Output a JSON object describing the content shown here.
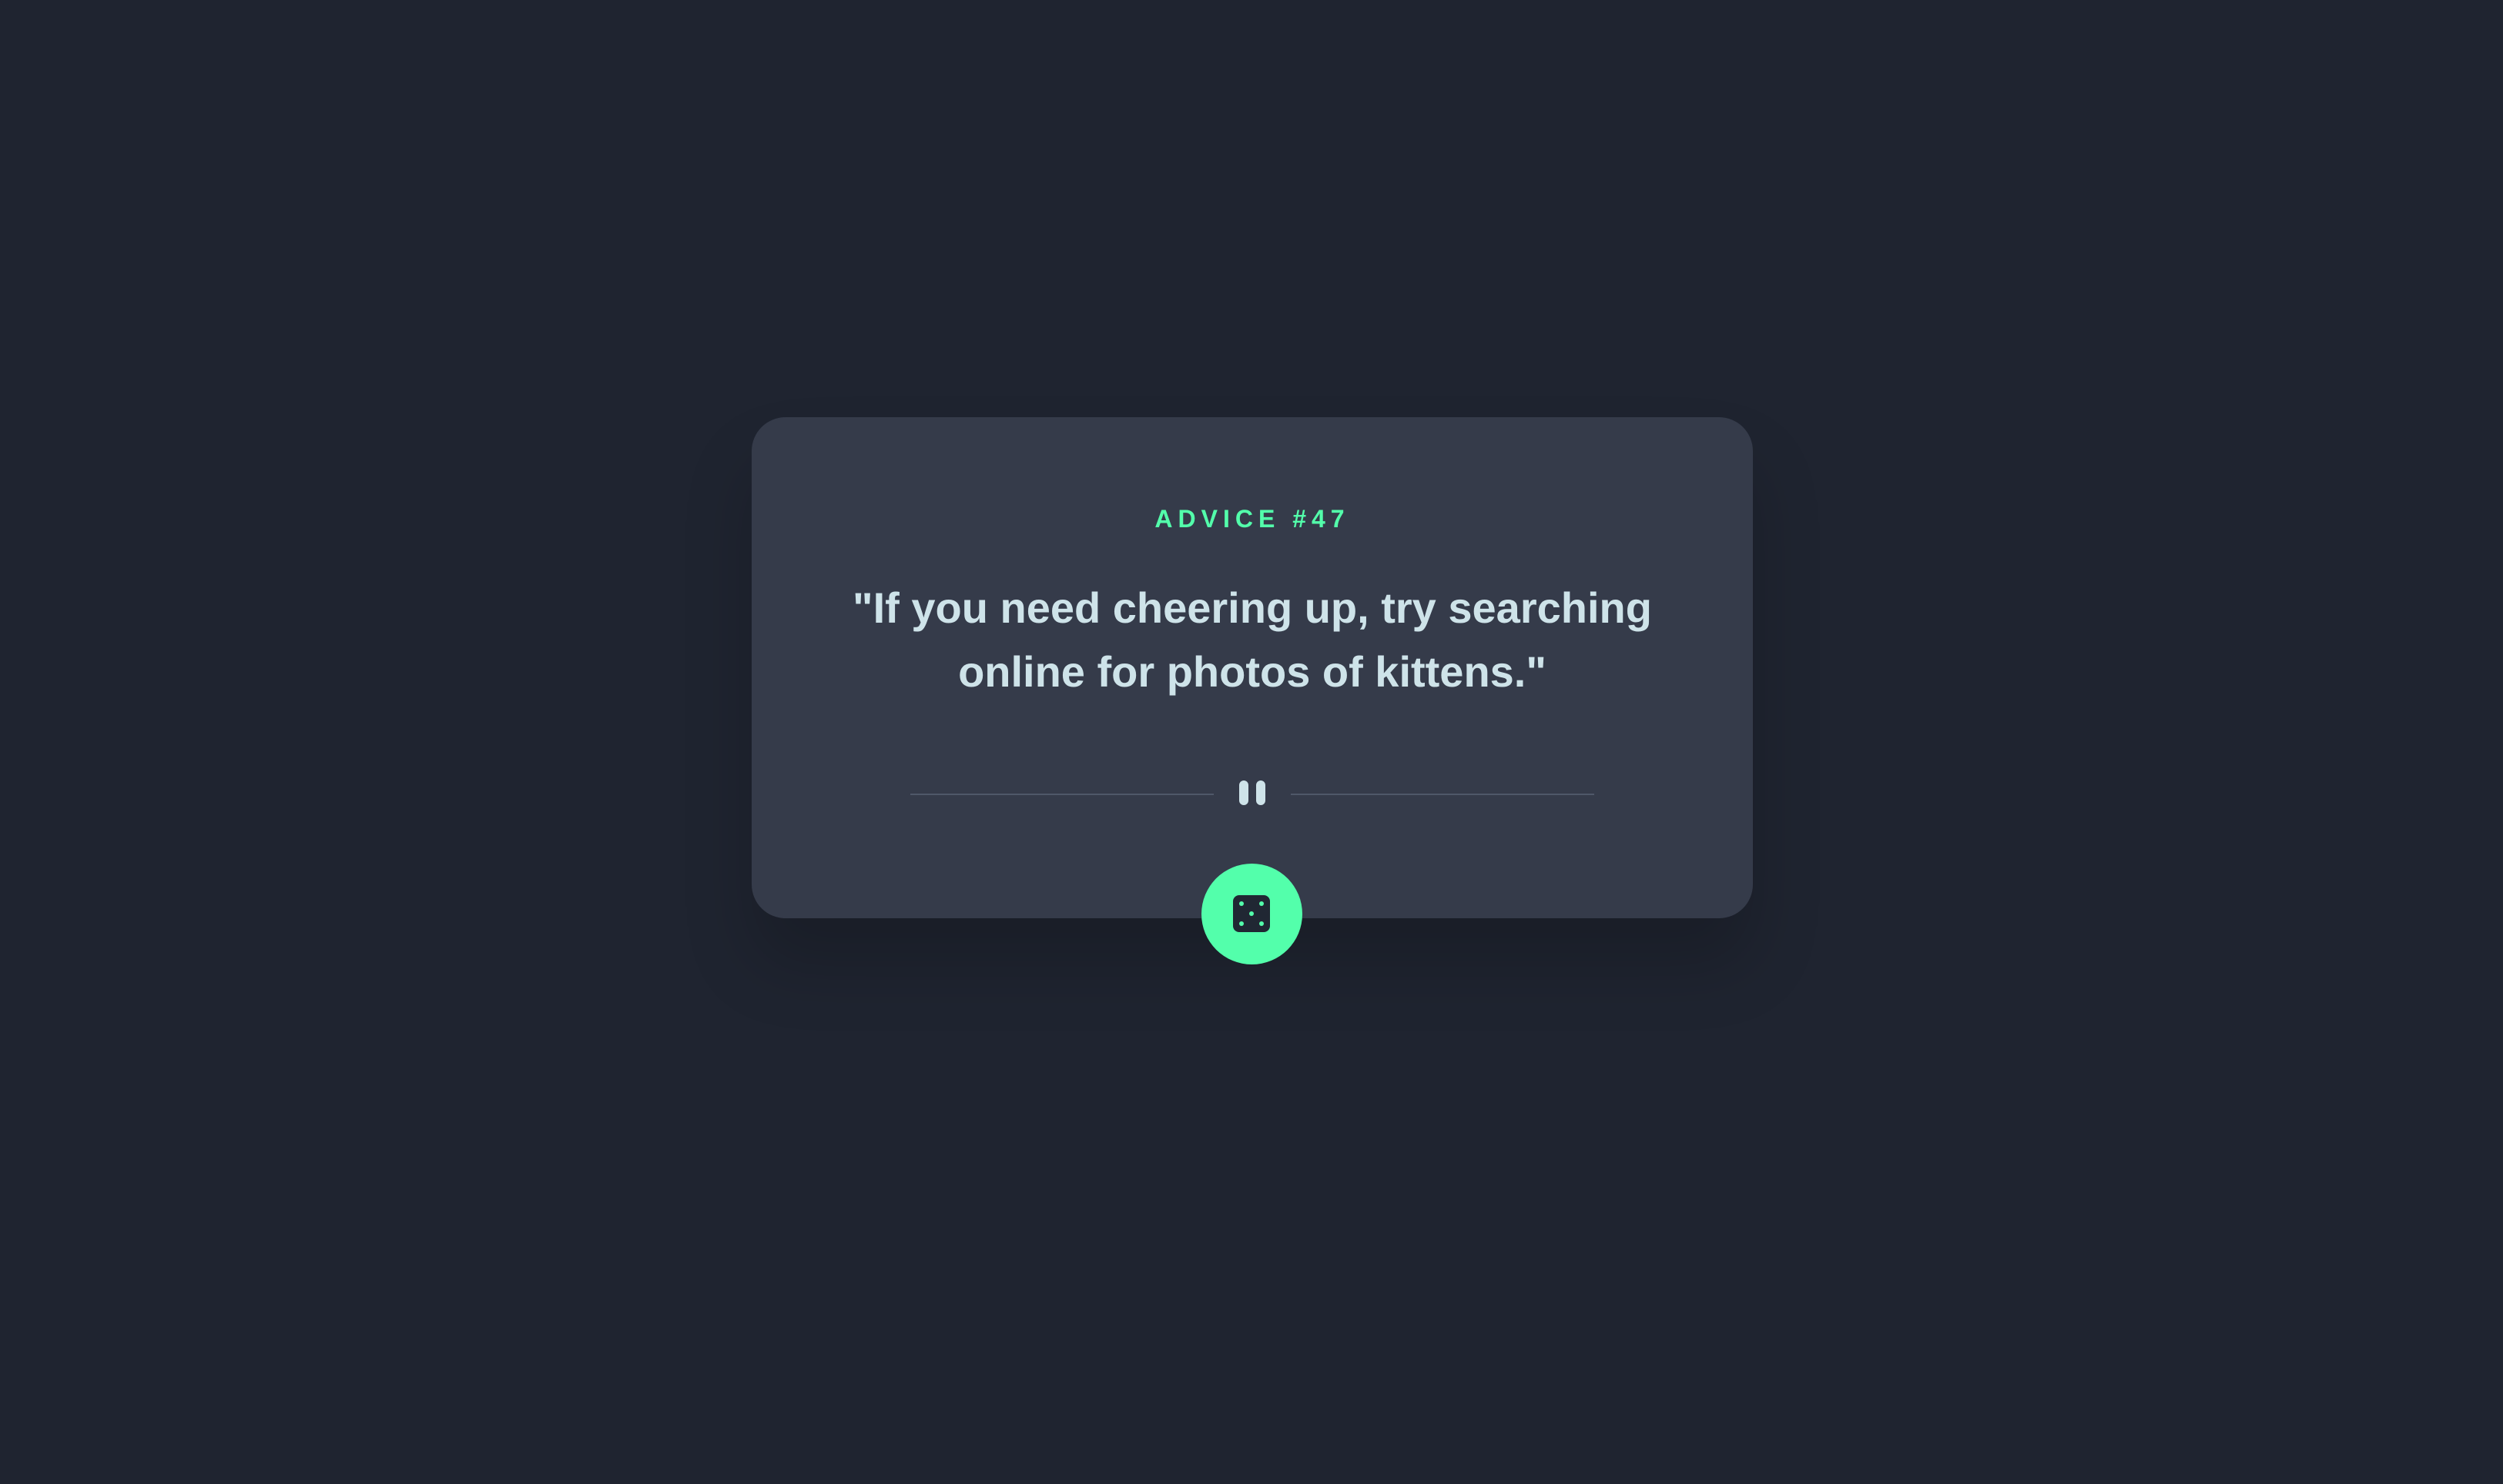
{
  "advice_card": {
    "heading": "ADVICE #47",
    "quote": "\"If you need cheering up, try searching online for photos of kittens.\""
  },
  "divider": {
    "icon": "pause-icon"
  },
  "dice_button": {
    "icon": "dice-icon",
    "accent_color": "#53ffab"
  },
  "colors": {
    "background": "#1f2430",
    "card": "#353b4a",
    "accent": "#53ffab",
    "text": "#cee3e9"
  }
}
